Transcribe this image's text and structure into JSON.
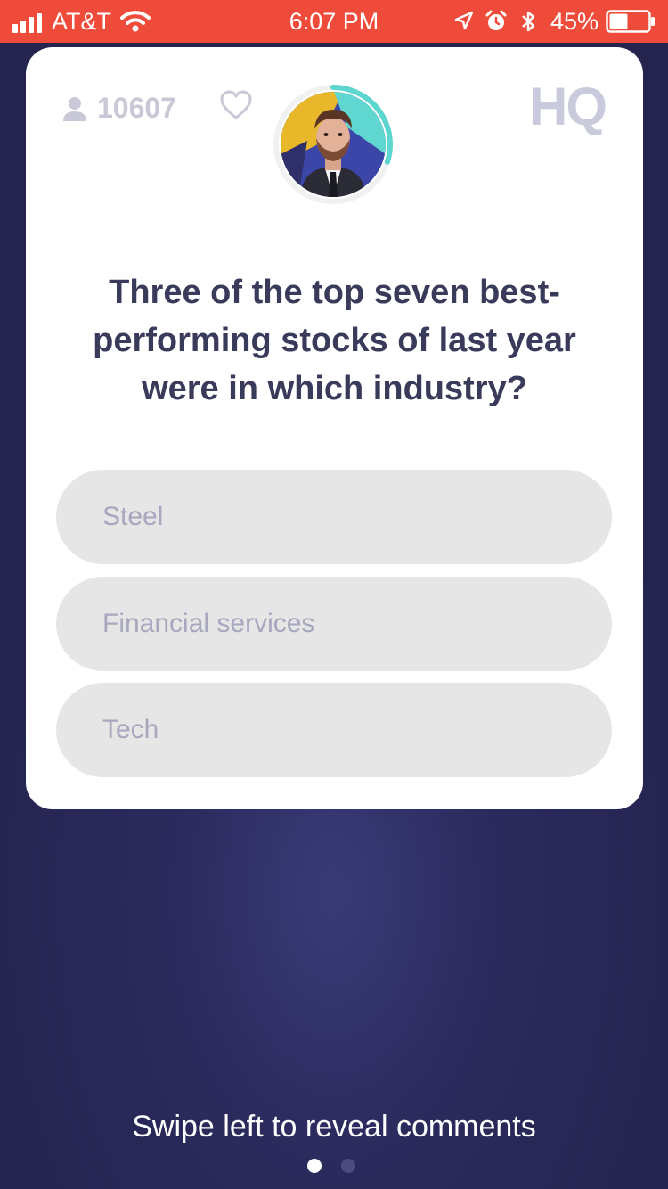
{
  "status_bar": {
    "carrier": "AT&T",
    "time": "6:07 PM",
    "battery": "45%",
    "icons": [
      "signal-icon",
      "wifi-icon",
      "location-icon",
      "alarm-icon",
      "bluetooth-icon",
      "battery-icon"
    ],
    "color": "#ef4b3a"
  },
  "game": {
    "viewer_count": "10607",
    "logo": "HQ",
    "question": "Three of the top seven best-performing stocks of last year were in which industry?",
    "answers": [
      "Steel",
      "Financial services",
      "Tech"
    ],
    "timer_progress": 0.3,
    "timer_color": "#5ed6d0"
  },
  "footer": {
    "hint": "Swipe left to reveal comments",
    "page_index": 1,
    "page_count": 2
  }
}
